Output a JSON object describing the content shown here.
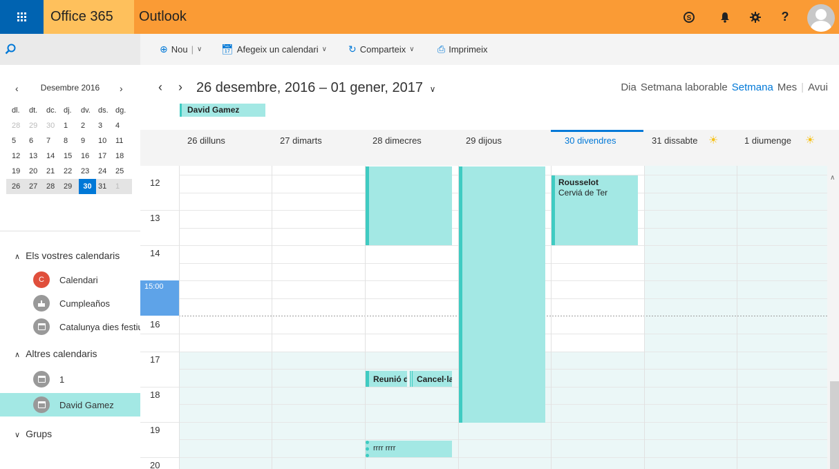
{
  "topbar": {
    "brand": "Office 365",
    "app": "Outlook"
  },
  "commands": {
    "new": "Nou",
    "add_calendar": "Afegeix un calendari",
    "share": "Comparteix",
    "print": "Imprimeix"
  },
  "mini_calendar": {
    "month_label": "Desembre 2016",
    "weekdays": [
      "dl.",
      "dt.",
      "dc.",
      "dj.",
      "dv.",
      "ds.",
      "dg."
    ],
    "weeks": [
      [
        "28",
        "29",
        "30",
        "1",
        "2",
        "3",
        "4"
      ],
      [
        "5",
        "6",
        "7",
        "8",
        "9",
        "10",
        "11"
      ],
      [
        "12",
        "13",
        "14",
        "15",
        "16",
        "17",
        "18"
      ],
      [
        "19",
        "20",
        "21",
        "22",
        "23",
        "24",
        "25"
      ],
      [
        "26",
        "27",
        "28",
        "29",
        "30",
        "31",
        "1"
      ]
    ],
    "today": "30"
  },
  "calendars": {
    "yours_heading": "Els vostres calendaris",
    "yours": [
      {
        "label": "Calendari",
        "initial": "C"
      },
      {
        "label": "Cumpleaños"
      },
      {
        "label": "Catalunya dies festius"
      }
    ],
    "other_heading": "Altres calendaris",
    "other": [
      {
        "label": "1"
      },
      {
        "label": "David Gamez"
      }
    ],
    "groups_heading": "Grups"
  },
  "header": {
    "range_title": "26 desembre, 2016 – 01 gener, 2017",
    "person": "David Gamez",
    "views": [
      "Dia",
      "Setmana laborable",
      "Setmana",
      "Mes",
      "Avui"
    ],
    "active_view": "Setmana"
  },
  "days": [
    "26 dilluns",
    "27 dimarts",
    "28 dimecres",
    "29 dijous",
    "30 divendres",
    "31 dissabte",
    "1 diumenge"
  ],
  "hours": [
    "12",
    "13",
    "14",
    "16",
    "17",
    "18",
    "19",
    "20"
  ],
  "now_label": "15:00",
  "events": [
    {
      "title": "Rousselot",
      "location": "Cerviá de Ter"
    },
    {
      "title": "Reunió d"
    },
    {
      "title": "Cancel·la"
    },
    {
      "title": "rrrr rrrr"
    }
  ],
  "colors": {
    "topbar": "#fa9b35",
    "brand_bg": "#fec05c",
    "waffle": "#0063b1",
    "accent": "#0078d7",
    "event_fill": "#a3e8e4",
    "event_border": "#3fcbc2",
    "workhours_off": "#ebf7f7"
  }
}
